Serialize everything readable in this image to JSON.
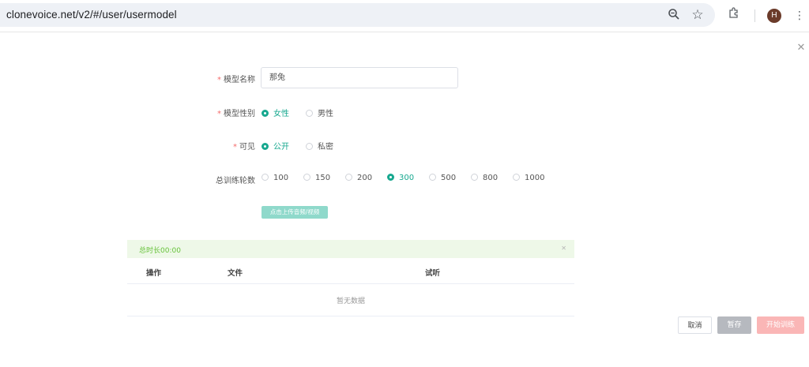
{
  "browser": {
    "url": "clonevoice.net/v2/#/user/usermodel",
    "avatar_letter": "H",
    "icons": [
      "zoom-icon",
      "star-icon",
      "extensions-icon",
      "profile-avatar",
      "menu-icon"
    ]
  },
  "form": {
    "name_label": "模型名称",
    "name_value": "那兔",
    "gender_label": "模型性别",
    "gender_options": [
      "女性",
      "男性"
    ],
    "gender_selected": "女性",
    "visibility_label": "可见",
    "visibility_options": [
      "公开",
      "私密"
    ],
    "visibility_selected": "公开",
    "epochs_label": "总训练轮数",
    "epoch_options": [
      "100",
      "150",
      "200",
      "300",
      "500",
      "800",
      "1000"
    ],
    "epoch_selected": "300",
    "upload_label": "点击上传音频/视频"
  },
  "files": {
    "total_duration": "总时长00:00",
    "columns": [
      "操作",
      "文件",
      "试听"
    ],
    "empty_text": "暂无数据"
  },
  "footer": {
    "cancel": "取消",
    "save": "暂存",
    "start_training": "开始训练"
  },
  "colors": {
    "accent": "#17a88f",
    "required": "#f56c6c",
    "alert_bg": "#eef8e8",
    "alert_text": "#67c23a",
    "start_btn": "#fab6b6"
  }
}
